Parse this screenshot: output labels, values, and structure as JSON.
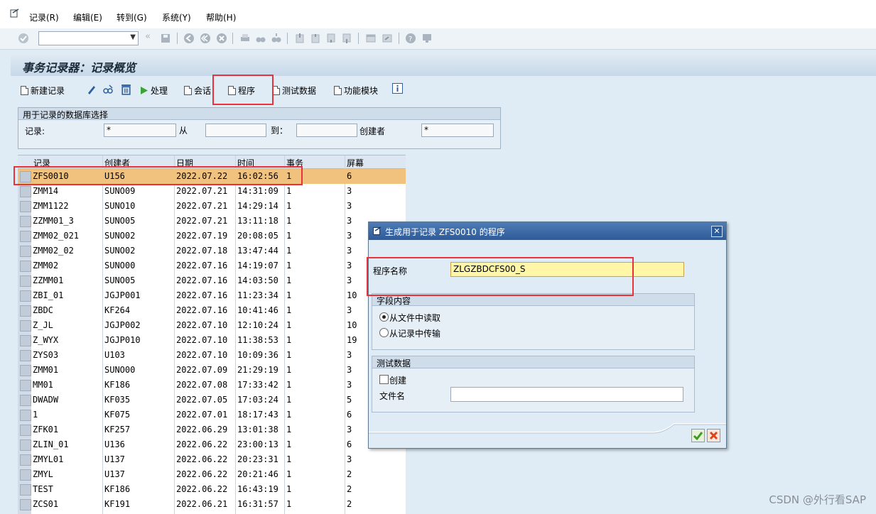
{
  "menu": [
    "记录(R)",
    "编辑(E)",
    "转到(G)",
    "系统(Y)",
    "帮助(H)"
  ],
  "page_title": "事务记录器：记录概览",
  "app_toolbar": {
    "new_recording": "新建记录",
    "process": "处理",
    "session": "会话",
    "program": "程序",
    "test_data": "测试数据",
    "function_module": "功能模块"
  },
  "selection": {
    "title": "用于记录的数据库选择",
    "recording_label": "记录:",
    "recording_value": "*",
    "from_label": "从",
    "from_value": "",
    "to_label": "到：",
    "to_value": "",
    "creator_label": "创建者",
    "creator_value": "*"
  },
  "table": {
    "headers": [
      "记录",
      "创建者",
      "日期",
      "时间",
      "事务",
      "屏幕"
    ],
    "rows": [
      [
        "ZFS0010",
        "U156",
        "2022.07.22",
        "16:02:56",
        "1",
        "6"
      ],
      [
        "ZMM14",
        "SUNO09",
        "2022.07.21",
        "14:31:09",
        "1",
        "3"
      ],
      [
        "ZMM1122",
        "SUNO10",
        "2022.07.21",
        "14:29:14",
        "1",
        "3"
      ],
      [
        "ZZMM01_3",
        "SUNO05",
        "2022.07.21",
        "13:11:18",
        "1",
        "3"
      ],
      [
        "ZMM02_021",
        "SUNO02",
        "2022.07.19",
        "20:08:05",
        "1",
        "3"
      ],
      [
        "ZMM02_02",
        "SUNO02",
        "2022.07.18",
        "13:47:44",
        "1",
        "3"
      ],
      [
        "ZMM02",
        "SUNO00",
        "2022.07.16",
        "14:19:07",
        "1",
        "3"
      ],
      [
        "ZZMM01",
        "SUNO05",
        "2022.07.16",
        "14:03:50",
        "1",
        "3"
      ],
      [
        "ZBI_01",
        "JGJP001",
        "2022.07.16",
        "11:23:34",
        "1",
        "10"
      ],
      [
        "ZBDC",
        "KF264",
        "2022.07.16",
        "10:41:46",
        "1",
        "3"
      ],
      [
        "Z_JL",
        "JGJP002",
        "2022.07.10",
        "12:10:24",
        "1",
        "10"
      ],
      [
        "Z_WYX",
        "JGJP010",
        "2022.07.10",
        "11:38:53",
        "1",
        "19"
      ],
      [
        "ZYS03",
        "U103",
        "2022.07.10",
        "10:09:36",
        "1",
        "3"
      ],
      [
        "ZMM01",
        "SUNO00",
        "2022.07.09",
        "21:29:19",
        "1",
        "3"
      ],
      [
        "MM01",
        "KF186",
        "2022.07.08",
        "17:33:42",
        "1",
        "3"
      ],
      [
        "DWADW",
        "KF035",
        "2022.07.05",
        "17:03:24",
        "1",
        "5"
      ],
      [
        "1",
        "KF075",
        "2022.07.01",
        "18:17:43",
        "1",
        "6"
      ],
      [
        "ZFK01",
        "KF257",
        "2022.06.29",
        "13:01:38",
        "1",
        "3"
      ],
      [
        "ZLIN_01",
        "U136",
        "2022.06.22",
        "23:00:13",
        "1",
        "6"
      ],
      [
        "ZMYL01",
        "U137",
        "2022.06.22",
        "20:23:31",
        "1",
        "3"
      ],
      [
        "ZMYL",
        "U137",
        "2022.06.22",
        "20:21:46",
        "1",
        "2"
      ],
      [
        "TEST",
        "KF186",
        "2022.06.22",
        "16:43:19",
        "1",
        "2"
      ],
      [
        "ZCS01",
        "KF191",
        "2022.06.21",
        "16:31:57",
        "1",
        "2"
      ]
    ]
  },
  "dialog": {
    "title": "生成用于记录 ZFS0010 的程序",
    "program_name_label": "程序名称",
    "program_name_value": "ZLGZBDCFS00_S",
    "field_content_title": "字段内容",
    "radio_from_file": "从文件中读取",
    "radio_from_recording": "从记录中传输",
    "radio_selected": "from_file",
    "test_data_title": "测试数据",
    "create_label": "创建",
    "create_checked": false,
    "filename_label": "文件名",
    "filename_value": ""
  },
  "watermark": "CSDN @外行看SAP",
  "colors": {
    "highlight": "#e8323c",
    "selected_row": "#f0c27e",
    "dialog_title": "#2e5b98"
  }
}
